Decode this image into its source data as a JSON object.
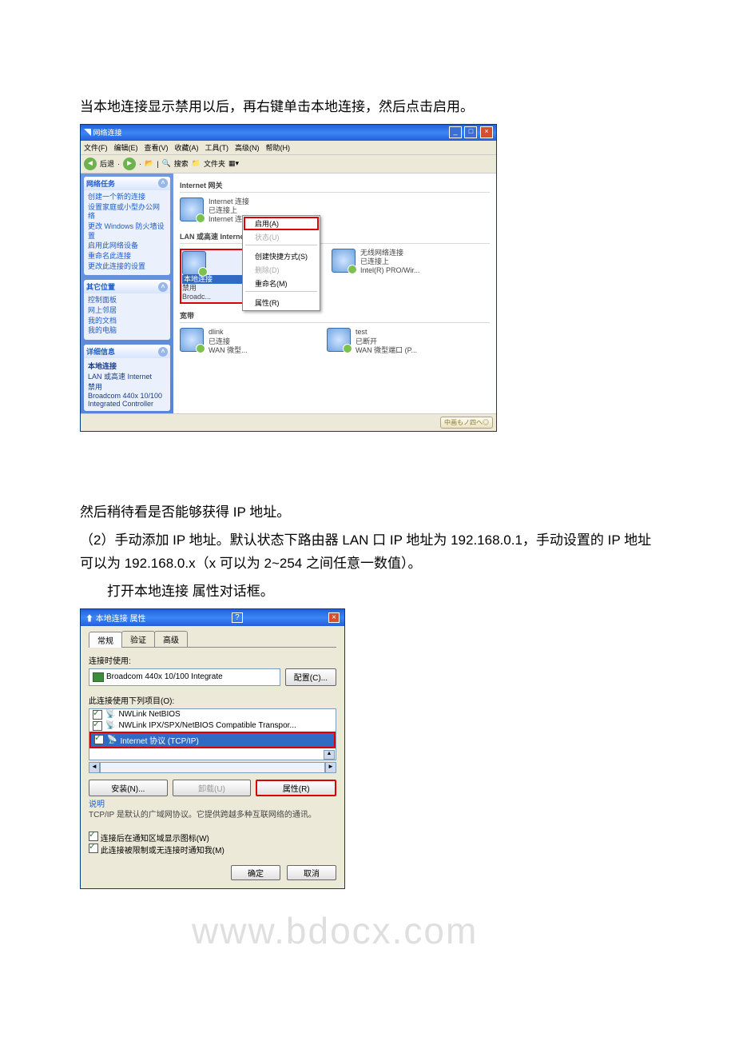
{
  "doc": {
    "p1": "当本地连接显示禁用以后，再右键单击本地连接，然后点击启用。",
    "p2": "然后稍待看是否能够获得 IP 地址。",
    "p3": "（2）手动添加 IP 地址。默认状态下路由器 LAN 口 IP 地址为 192.168.0.1，手动设置的 IP 地址可以为 192.168.0.x（x 可以为 2~254 之间任意一数值）。",
    "p4": "打开本地连接 属性对话框。"
  },
  "watermark": "www.bdocx.com",
  "explorer": {
    "title": "网络连接",
    "menu": [
      "文件(F)",
      "编辑(E)",
      "查看(V)",
      "收藏(A)",
      "工具(T)",
      "高级(N)",
      "帮助(H)"
    ],
    "tools": {
      "back": "后退",
      "search": "搜索",
      "folders": "文件夹"
    },
    "side": {
      "tasks_hd": "网络任务",
      "tasks": [
        "创建一个新的连接",
        "设置家庭或小型办公网络",
        "更改 Windows 防火墙设置",
        "启用此网络设备",
        "重命名此连接",
        "更改此连接的设置"
      ],
      "other_hd": "其它位置",
      "other": [
        "控制面板",
        "网上邻居",
        "我的文档",
        "我的电脑"
      ],
      "detail_hd": "详细信息",
      "detail_title": "本地连接",
      "detail_l1": "LAN 或高速 Internet",
      "detail_l2": "禁用",
      "detail_l3": "Broadcom 440x 10/100 Integrated Controller"
    },
    "main": {
      "grp1": "Internet 网关",
      "ic_name": "Internet 连接",
      "ic_s1": "已连接上",
      "ic_s2": "Internet 连接",
      "grp2": "LAN 或高速 Internet",
      "lc_name": "本地连接",
      "lc_s1": "禁用",
      "lc_s2": "Broadc...",
      "wl_name": "无线网络连接",
      "wl_s1": "已连接上",
      "wl_s2": "Intel(R) PRO/Wir...",
      "dl_name": "dlink",
      "dl_s1": "已连接",
      "dl_s2": "WAN 微型...",
      "tt_name": "test",
      "tt_s1": "已断开",
      "tt_s2": "WAN 微型端口 (P...",
      "grp3": "宽带",
      "ctx": {
        "enable": "启用(A)",
        "status": "状态(U)",
        "shortcut": "创建快捷方式(S)",
        "delete": "删除(D)",
        "rename": "重命名(M)",
        "props": "属性(R)"
      }
    },
    "tray": "中画もノ四ヘ◎"
  },
  "dlg": {
    "title": "本地连接 属性",
    "tabs": [
      "常规",
      "验证",
      "高级"
    ],
    "conn_lbl": "连接时使用:",
    "adapter": "Broadcom 440x 10/100 Integrate",
    "config": "配置(C)...",
    "items_lbl": "此连接使用下列项目(O):",
    "items": [
      "NWLink NetBIOS",
      "NWLink IPX/SPX/NetBIOS Compatible Transpor...",
      "Internet 协议 (TCP/IP)"
    ],
    "install": "安装(N)...",
    "uninstall": "卸载(U)",
    "props": "属性(R)",
    "expl_hd": "说明",
    "expl": "TCP/IP 是默认的广域网协议。它提供跨越多种互联网络的通讯。",
    "chk1": "连接后在通知区域显示图标(W)",
    "chk2": "此连接被限制或无连接时通知我(M)",
    "ok": "确定",
    "cancel": "取消"
  }
}
